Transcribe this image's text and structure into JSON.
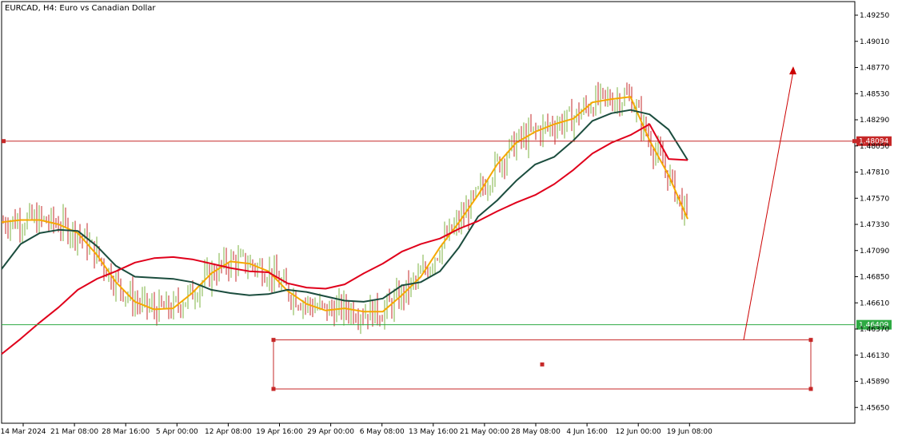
{
  "header": {
    "title": "EURCAD, H4:  Euro vs Canadian Dollar"
  },
  "colors": {
    "background": "#ffffff",
    "frame": "#000000",
    "candle_up": "#7cb342",
    "candle_down": "#c62828",
    "ma_fast": "#f5a800",
    "ma_mid": "#1b4d3e",
    "ma_slow": "#e0001b",
    "resistance_line": "#c62828",
    "current_price_line": "#2eaa43",
    "zone_border": "#c62828",
    "arrow": "#cc0000"
  },
  "chart_data": {
    "type": "candlestick",
    "symbol": "EURCAD",
    "timeframe": "H4",
    "title": "EURCAD, H4:  Euro vs Canadian Dollar",
    "ylim": [
      1.4542,
      1.4941
    ],
    "y_ticks": [
      "1.49250",
      "1.49010",
      "1.48770",
      "1.48530",
      "1.48290",
      "1.48050",
      "1.47810",
      "1.47570",
      "1.47330",
      "1.47090",
      "1.46850",
      "1.46610",
      "1.46370",
      "1.46130",
      "1.45890",
      "1.45650"
    ],
    "x_ticks": [
      "14 Mar 2024",
      "21 Mar 08:00",
      "28 Mar 16:00",
      "5 Apr 00:00",
      "12 Apr 08:00",
      "19 Apr 16:00",
      "29 Apr 00:00",
      "6 May 08:00",
      "13 May 16:00",
      "21 May 00:00",
      "28 May 08:00",
      "4 Jun 16:00",
      "12 Jun 00:00",
      "19 Jun 08:00"
    ],
    "horizontal_levels": [
      {
        "price": 1.48094,
        "label": "1.48094",
        "kind": "resistance"
      },
      {
        "price": 1.46409,
        "label": "1.46409",
        "kind": "current"
      }
    ],
    "zone": {
      "top": 1.4627,
      "bottom": 1.4582,
      "from_index": 1,
      "to_index": 18
    },
    "arrow": {
      "from_price": 1.4627,
      "to_price": 1.4878,
      "direction": "up"
    },
    "ma_series": [
      {
        "color_key": "ma_fast",
        "anchors": [
          1.4735,
          1.4737,
          1.4737,
          1.4733,
          1.4725,
          1.4705,
          1.468,
          1.4662,
          1.4655,
          1.4656,
          1.467,
          1.4688,
          1.4699,
          1.4697,
          1.469,
          1.4672,
          1.466,
          1.4654,
          1.4656,
          1.4653,
          1.4653,
          1.4668,
          1.4685,
          1.4712,
          1.4735,
          1.476,
          1.4788,
          1.4808,
          1.4818,
          1.4825,
          1.483,
          1.4845,
          1.4848,
          1.485,
          1.481,
          1.4778,
          1.4738
        ]
      },
      {
        "color_key": "ma_mid",
        "anchors": [
          1.4692,
          1.4715,
          1.4725,
          1.4728,
          1.4727,
          1.4713,
          1.4695,
          1.4685,
          1.4684,
          1.4683,
          1.468,
          1.4673,
          1.467,
          1.4668,
          1.4669,
          1.4673,
          1.4671,
          1.4667,
          1.4663,
          1.4662,
          1.4665,
          1.4677,
          1.468,
          1.469,
          1.4712,
          1.474,
          1.4755,
          1.4773,
          1.4788,
          1.4795,
          1.481,
          1.4828,
          1.4835,
          1.4838,
          1.4834,
          1.482,
          1.4792
        ]
      },
      {
        "color_key": "ma_slow",
        "anchors": [
          1.4614,
          1.4628,
          1.4643,
          1.4657,
          1.4673,
          1.4683,
          1.469,
          1.4698,
          1.4702,
          1.4703,
          1.4701,
          1.4697,
          1.4693,
          1.469,
          1.4689,
          1.4679,
          1.4675,
          1.4674,
          1.4678,
          1.4688,
          1.4697,
          1.4708,
          1.4715,
          1.472,
          1.4729,
          1.4736,
          1.4745,
          1.4753,
          1.476,
          1.477,
          1.4783,
          1.4798,
          1.4808,
          1.4815,
          1.4825,
          1.4793,
          1.4792
        ]
      }
    ]
  }
}
